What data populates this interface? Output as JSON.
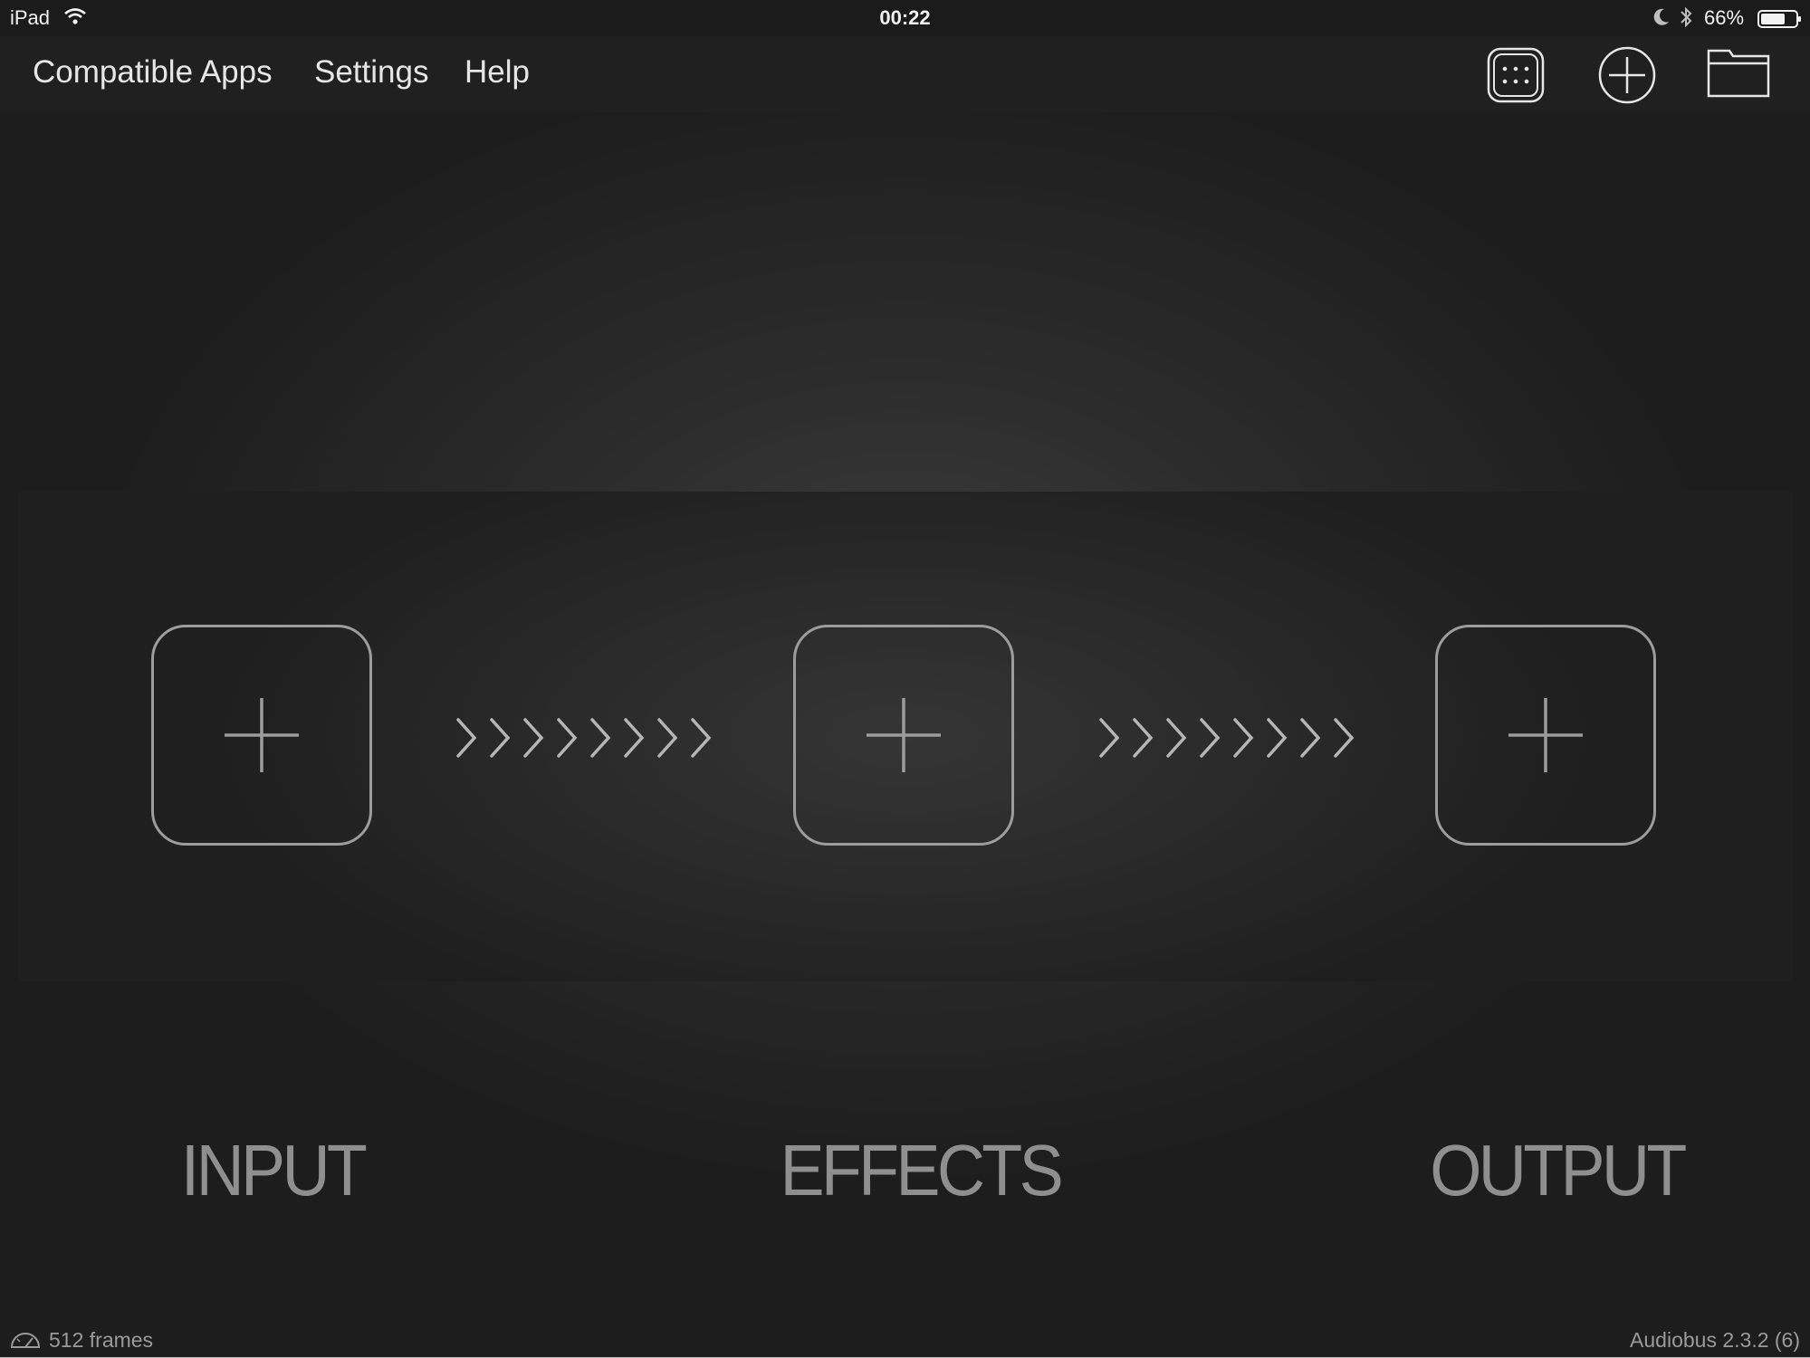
{
  "status_bar": {
    "device": "iPad",
    "time": "00:22",
    "battery_percent": "66%",
    "icons": [
      "wifi-icon",
      "moon-icon",
      "bluetooth-icon",
      "battery-icon"
    ]
  },
  "nav": {
    "links": [
      "Compatible Apps",
      "Settings",
      "Help"
    ],
    "icons": [
      "app-grid-icon",
      "add-circle-icon",
      "folder-icon"
    ]
  },
  "pipeline": {
    "slots": [
      "input",
      "effects",
      "output"
    ],
    "connector_icon": "chevrons-icon",
    "slot_icon": "plus-icon"
  },
  "labels": {
    "input": "INPUT",
    "effects": "EFFECTS",
    "output": "OUTPUT"
  },
  "footer": {
    "frames": "512 frames",
    "version": "Audiobus 2.3.2 (6)",
    "gauge_icon": "latency-gauge-icon"
  },
  "colors": {
    "background": "#2c2c2c",
    "bars": "#1b1b1b",
    "outline": "#9c9c9c",
    "text": "#e6e6e6"
  }
}
